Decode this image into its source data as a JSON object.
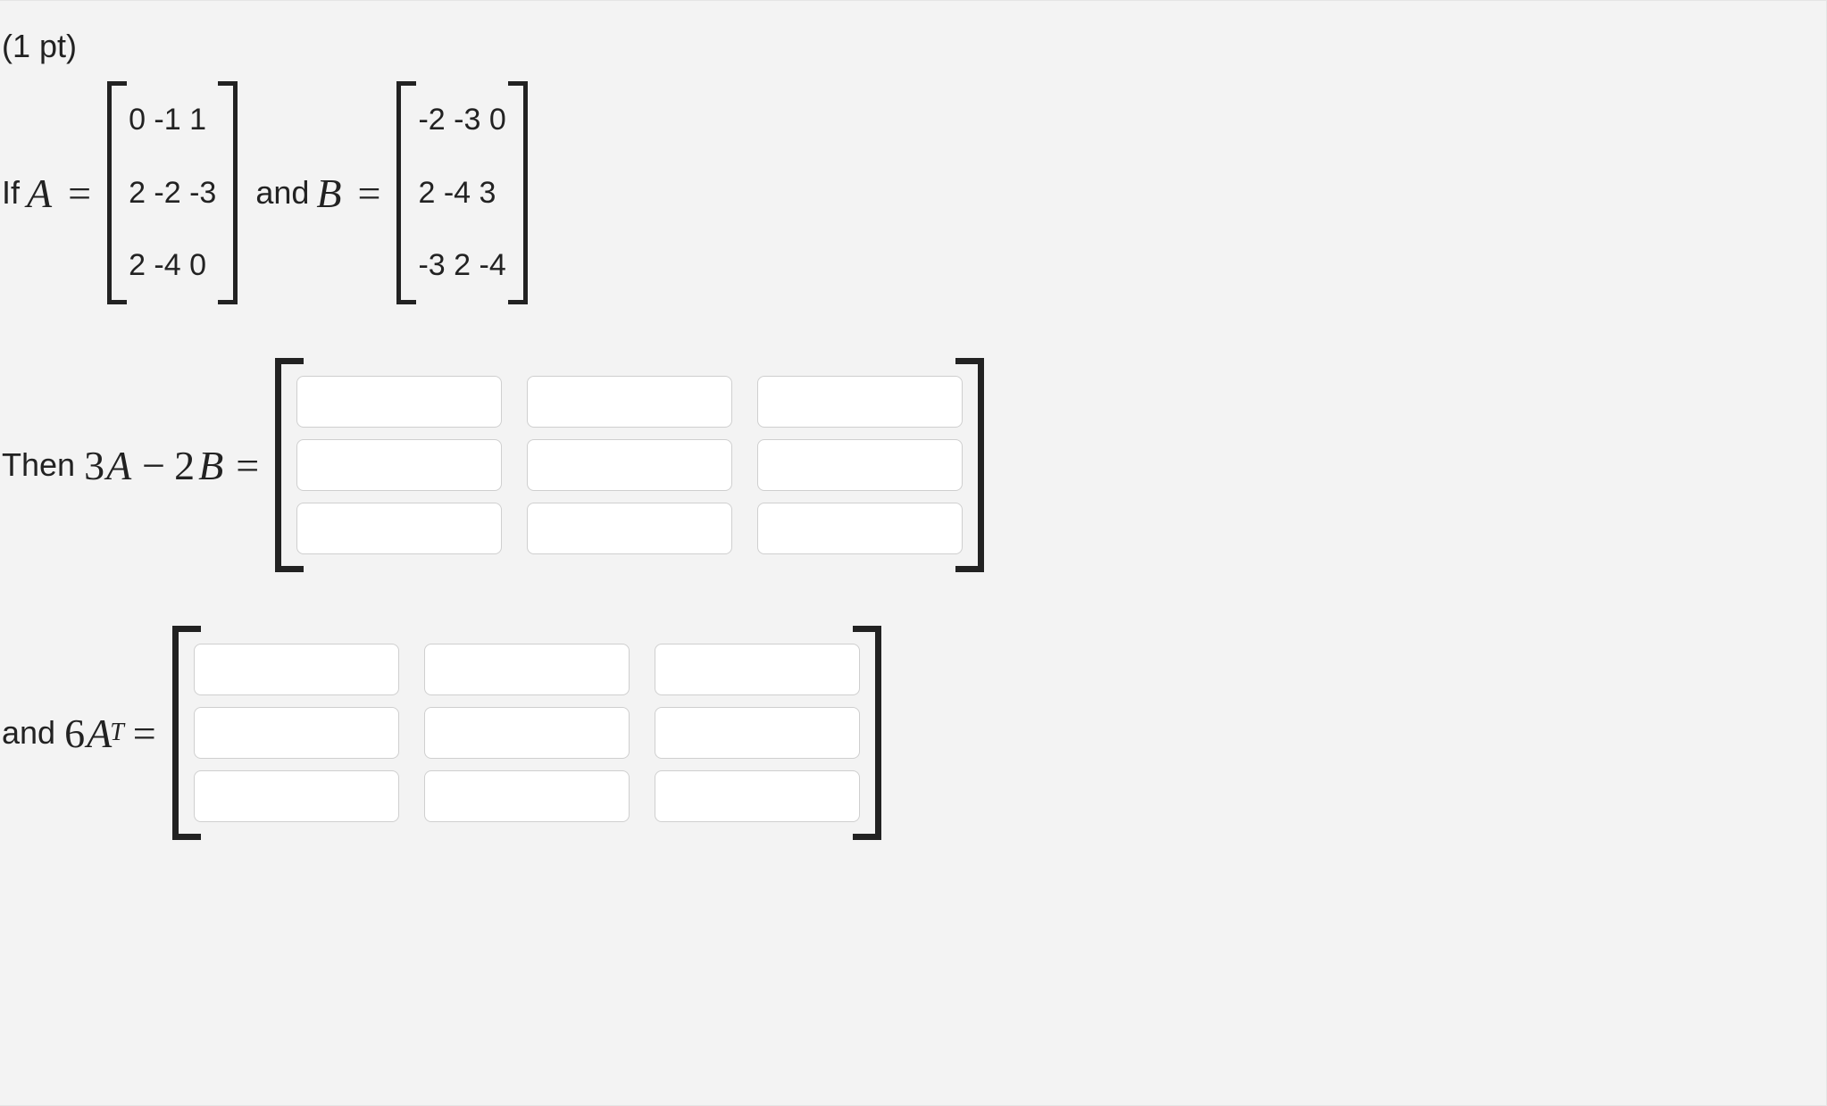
{
  "points_label": "(1 pt)",
  "line1": {
    "if": "If",
    "A": "A",
    "eq": "=",
    "matrixA": {
      "rows": [
        "0 -1 1",
        "2 -2 -3",
        "2 -4 0"
      ]
    },
    "and": "and",
    "B": "B",
    "matrixB": {
      "rows": [
        "-2 -3 0",
        "2 -4 3",
        "-3 2 -4"
      ]
    }
  },
  "line2": {
    "then": "Then",
    "expr_num1": "3",
    "expr_A": "A",
    "minus": "−",
    "expr_num2": "2",
    "expr_B": "B",
    "eq": "="
  },
  "line3": {
    "and": "and",
    "expr_num": "6",
    "expr_A": "A",
    "sup": "T",
    "eq": "="
  },
  "answers": {
    "m1": [
      [
        "",
        "",
        ""
      ],
      [
        "",
        "",
        ""
      ],
      [
        "",
        "",
        ""
      ]
    ],
    "m2": [
      [
        "",
        "",
        ""
      ],
      [
        "",
        "",
        ""
      ],
      [
        "",
        "",
        ""
      ]
    ]
  }
}
